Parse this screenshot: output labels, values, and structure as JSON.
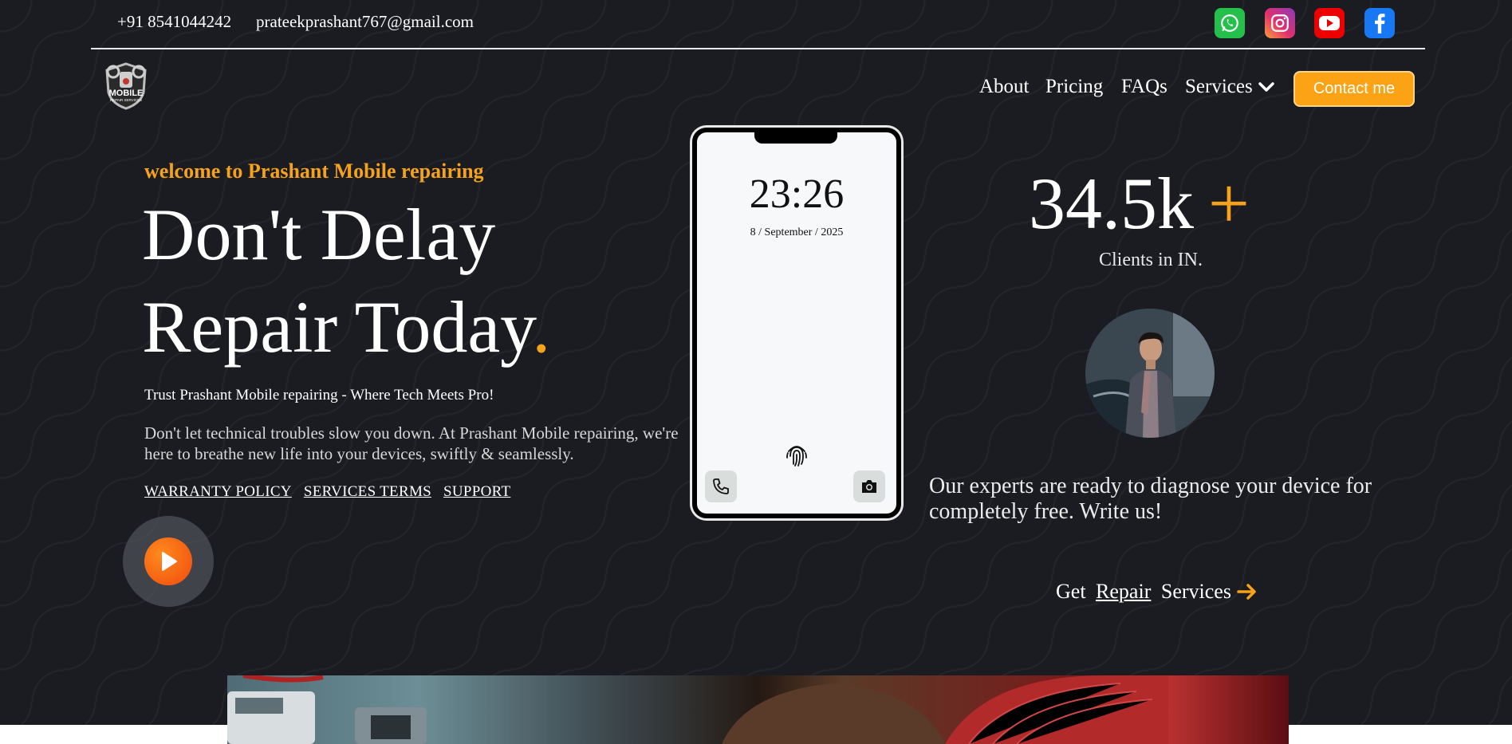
{
  "topbar": {
    "phone": "+91 8541044242",
    "email": "prateekprashant767@gmail.com",
    "socials": [
      {
        "name": "whatsapp-icon",
        "color": "#25c04b"
      },
      {
        "name": "instagram-icon",
        "color": "#e1306c"
      },
      {
        "name": "youtube-icon",
        "color": "#ee0000"
      },
      {
        "name": "facebook-icon",
        "color": "#1877f2"
      }
    ]
  },
  "logo": {
    "line1": "MOBILE",
    "line2": "REPAIR SERVICES"
  },
  "nav": {
    "about": "About",
    "pricing": "Pricing",
    "faqs": "FAQs",
    "services": "Services",
    "contact": "Contact me"
  },
  "hero": {
    "welcome": "welcome to Prashant Mobile repairing",
    "headline_line1": "Don't Delay",
    "headline_line2": "Repair Today",
    "headline_dot": ".",
    "tagline": "Trust Prashant Mobile repairing - Where Tech Meets Pro!",
    "description": "Don't let technical troubles slow you down. At Prashant Mobile repairing, we're here to breathe new life into your devices, swiftly & seamlessly.",
    "links": [
      "WARRANTY POLICY",
      "SERVICES TERMS",
      "SUPPORT"
    ]
  },
  "phone_mockup": {
    "time": "23:26",
    "date": "8 / September / 2025"
  },
  "stats": {
    "value": "34.5k",
    "plus": "+",
    "label": "Clients in IN."
  },
  "experts_text": "Our experts are ready to diagnose your device for completely free. Write us!",
  "cta": {
    "prefix": "Get ",
    "highlight": "Repair",
    "suffix": " Services"
  },
  "colors": {
    "accent": "#f6a21a",
    "background": "#1b1c22",
    "button": "#fba314"
  }
}
